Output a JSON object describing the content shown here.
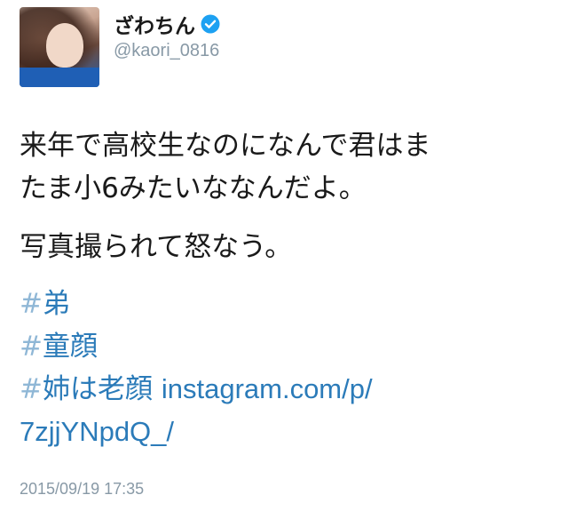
{
  "user": {
    "display_name": "ざわちん",
    "handle": "@kaori_0816",
    "verified": true,
    "avatar_icon": "profile-photo"
  },
  "tweet": {
    "line1": "来年で高校生なのになんで君はま",
    "line2": "たま小6みたいななんだよ。",
    "line3": "写真撮られて怒なう。",
    "hashtags": [
      {
        "hash": "#",
        "tag": "弟"
      },
      {
        "hash": "#",
        "tag": "童顔"
      },
      {
        "hash": "#",
        "tag": "姉は老顔"
      }
    ],
    "link_part1": "instagram.com/p/",
    "link_part2": "7zjjYNpdQ_/",
    "timestamp": "2015/09/19 17:35"
  },
  "colors": {
    "link": "#2b7bb9",
    "hash": "#8fb7d6",
    "meta": "#8899a6",
    "verified": "#1da1f2"
  }
}
